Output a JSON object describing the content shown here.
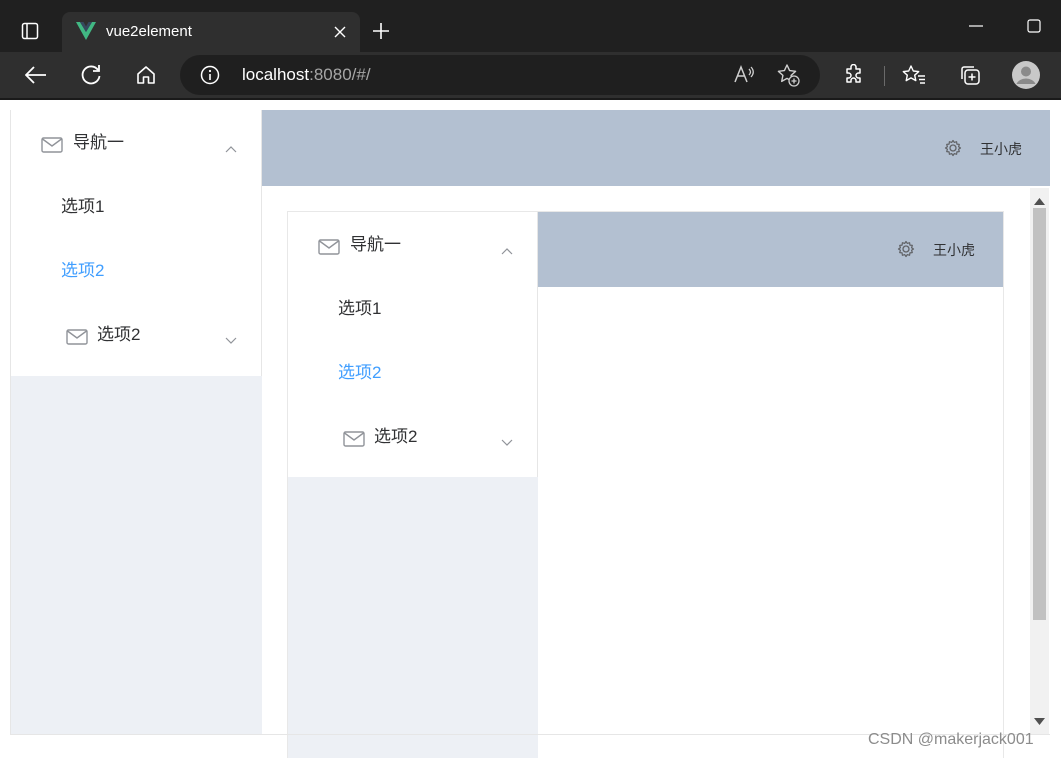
{
  "browser": {
    "tab_title": "vue2element",
    "url_host": "localhost",
    "url_rest": ":8080/#/"
  },
  "outer": {
    "nav_group": "导航一",
    "items": [
      "选项1",
      "选项2"
    ],
    "active_item": "选项2",
    "submenu": "选项2",
    "username": "王小虎"
  },
  "inner": {
    "nav_group": "导航一",
    "items": [
      "选项1",
      "选项2"
    ],
    "active_item": "选项2",
    "submenu": "选项2",
    "username": "王小虎"
  },
  "watermark": "CSDN @makerjack001",
  "colors": {
    "active": "#409eff",
    "header_bg": "#b3c0d1",
    "aside_bg": "#edf0f5"
  },
  "icons": [
    "tab-actions-icon",
    "vue-logo-icon",
    "close-icon",
    "plus-icon",
    "minimize-icon",
    "maximize-icon",
    "back-icon",
    "refresh-icon",
    "home-icon",
    "info-icon",
    "read-aloud-icon",
    "add-favorite-icon",
    "extensions-icon",
    "favorites-icon",
    "collections-icon",
    "profile-icon",
    "mail-icon",
    "chevron-up-icon",
    "chevron-down-icon",
    "gear-icon"
  ]
}
